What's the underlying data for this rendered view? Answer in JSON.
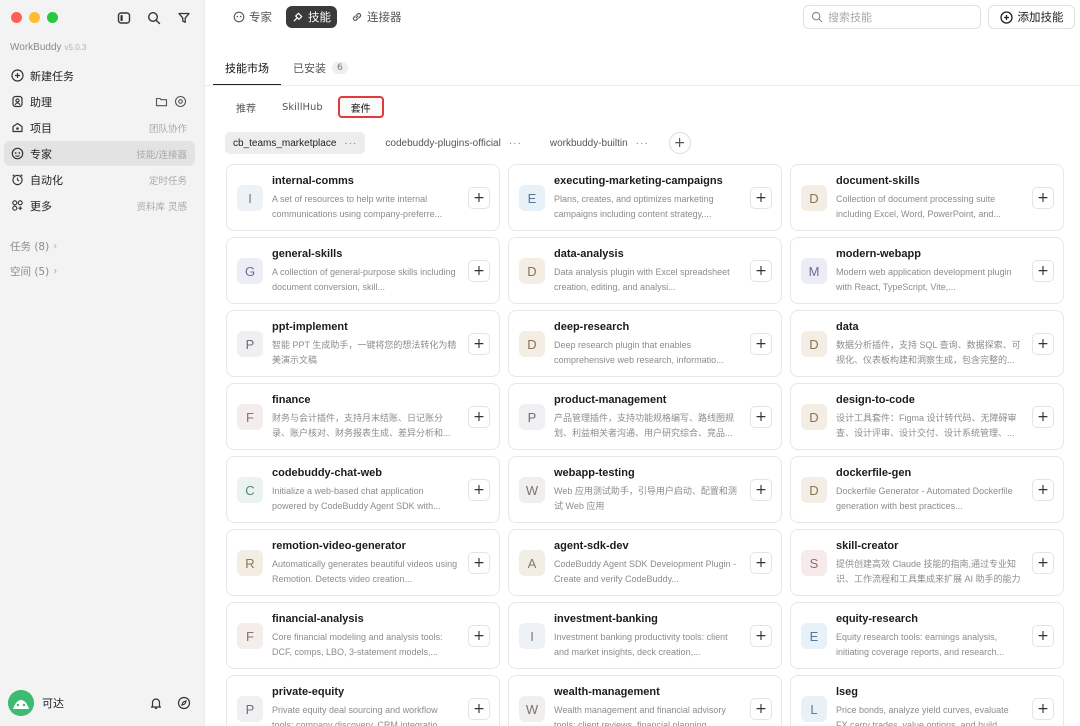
{
  "sidebar": {
    "brand": "WorkBuddy",
    "version": "v5.0.3",
    "items": [
      {
        "label": "新建任务",
        "hint": "",
        "icon": "plus-circle-icon"
      },
      {
        "label": "助理",
        "hint": "",
        "icon": "assistant-icon"
      },
      {
        "label": "项目",
        "hint": "团队协作",
        "icon": "project-icon"
      },
      {
        "label": "专家",
        "hint": "技能/连接器",
        "icon": "expert-icon",
        "active": true
      },
      {
        "label": "自动化",
        "hint": "定时任务",
        "icon": "alarm-icon"
      },
      {
        "label": "更多",
        "hint": "资料库 灵感",
        "icon": "more-grid-icon"
      }
    ],
    "sections": [
      {
        "label": "任务 (8)"
      },
      {
        "label": "空间 (5)"
      }
    ],
    "user": {
      "name": "可达"
    }
  },
  "topbar": {
    "tabs": [
      {
        "label": "专家",
        "icon": "expert-icon"
      },
      {
        "label": "技能",
        "icon": "skill-icon",
        "active": true
      },
      {
        "label": "连接器",
        "icon": "link-icon"
      }
    ],
    "search_placeholder": "搜索技能",
    "add_skill_label": "添加技能"
  },
  "subtabs": [
    {
      "label": "技能市场",
      "active": true
    },
    {
      "label": "已安装",
      "count": "6"
    }
  ],
  "segments": [
    {
      "label": "推荐"
    },
    {
      "label": "SkillHub"
    },
    {
      "label": "套件",
      "active": true
    }
  ],
  "sources": [
    {
      "label": "cb_teams_marketplace",
      "active": true
    },
    {
      "label": "codebuddy-plugins-official"
    },
    {
      "label": "workbuddy-builtin"
    }
  ],
  "cards": [
    {
      "letter": "I",
      "name": "internal-comms",
      "desc": "A set of resources to help write internal communications using company-preferre..."
    },
    {
      "letter": "E",
      "name": "executing-marketing-campaigns",
      "desc": "Plans, creates, and optimizes marketing campaigns including content strategy,..."
    },
    {
      "letter": "D",
      "name": "document-skills",
      "desc": "Collection of document processing suite including Excel, Word, PowerPoint, and..."
    },
    {
      "letter": "G",
      "name": "general-skills",
      "desc": "A collection of general-purpose skills including document conversion, skill..."
    },
    {
      "letter": "D",
      "name": "data-analysis",
      "desc": "Data analysis plugin with Excel spreadsheet creation, editing, and analysi..."
    },
    {
      "letter": "M",
      "name": "modern-webapp",
      "desc": "Modern web application development plugin with React, TypeScript, Vite,..."
    },
    {
      "letter": "P",
      "name": "ppt-implement",
      "desc": "智能 PPT 生成助手，一键将您的想法转化为精美演示文稿"
    },
    {
      "letter": "D",
      "name": "deep-research",
      "desc": "Deep research plugin that enables comprehensive web research, informatio..."
    },
    {
      "letter": "D",
      "name": "data",
      "desc": "数据分析插件，支持 SQL 查询、数据探索、可视化、仪表板构建和洞察生成，包含完整的..."
    },
    {
      "letter": "F",
      "name": "finance",
      "desc": "财务与会计插件，支持月末结账、日记账分录、账户核对、财务报表生成、差异分析和..."
    },
    {
      "letter": "P",
      "name": "product-management",
      "desc": "产品管理插件，支持功能规格编写、路线图规划、利益相关者沟通、用户研究综合、竞品..."
    },
    {
      "letter": "D",
      "name": "design-to-code",
      "desc": "设计工具套件：Figma 设计转代码、无障碍审查、设计评审、设计交付、设计系统管理、..."
    },
    {
      "letter": "C",
      "name": "codebuddy-chat-web",
      "desc": "Initialize a web-based chat application powered by CodeBuddy Agent SDK with..."
    },
    {
      "letter": "W",
      "name": "webapp-testing",
      "desc": "Web 应用测试助手，引导用户启动、配置和测试 Web 应用"
    },
    {
      "letter": "D",
      "name": "dockerfile-gen",
      "desc": "Dockerfile Generator - Automated Dockerfile generation with best practices..."
    },
    {
      "letter": "R",
      "name": "remotion-video-generator",
      "desc": "Automatically generates beautiful videos using Remotion. Detects video creation..."
    },
    {
      "letter": "A",
      "name": "agent-sdk-dev",
      "desc": "CodeBuddy Agent SDK Development Plugin - Create and verify CodeBuddy..."
    },
    {
      "letter": "S",
      "name": "skill-creator",
      "desc": "提供创建高效 Claude 技能的指南,通过专业知识、工作流程和工具集成来扩展 AI 助手的能力"
    },
    {
      "letter": "F",
      "name": "financial-analysis",
      "desc": "Core financial modeling and analysis tools: DCF, comps, LBO, 3-statement models,..."
    },
    {
      "letter": "I",
      "name": "investment-banking",
      "desc": "Investment banking productivity tools: client and market insights, deck creation,..."
    },
    {
      "letter": "E",
      "name": "equity-research",
      "desc": "Equity research tools: earnings analysis, initiating coverage reports, and research..."
    },
    {
      "letter": "P",
      "name": "private-equity",
      "desc": "Private equity deal sourcing and workflow tools: company discovery, CRM integratio..."
    },
    {
      "letter": "W",
      "name": "wealth-management",
      "desc": "Wealth management and financial advisory tools: client reviews, financial planning..."
    },
    {
      "letter": "L",
      "name": "lseg",
      "desc": "Price bonds, analyze yield curves, evaluate FX carry trades, value options, and build..."
    }
  ],
  "letter_colors": {
    "I": [
      "#eef1f6",
      "#6d7a8c"
    ],
    "E": [
      "#e8f0f8",
      "#5a7896"
    ],
    "D": [
      "#f3ede3",
      "#8a7355"
    ],
    "G": [
      "#ecedf7",
      "#6a6f95"
    ],
    "M": [
      "#ececf6",
      "#6b6d93"
    ],
    "P": [
      "#f0f0f3",
      "#6f6f78"
    ],
    "F": [
      "#f3eeec",
      "#8a716b"
    ],
    "C": [
      "#eaf3ef",
      "#5b8472"
    ],
    "W": [
      "#f0efed",
      "#7a746d"
    ],
    "R": [
      "#f2eee4",
      "#8a7a55"
    ],
    "A": [
      "#f1eee6",
      "#857a60"
    ],
    "S": [
      "#f6eaea",
      "#9b6868"
    ],
    "L": [
      "#eaf1f6",
      "#5f7d94"
    ]
  }
}
